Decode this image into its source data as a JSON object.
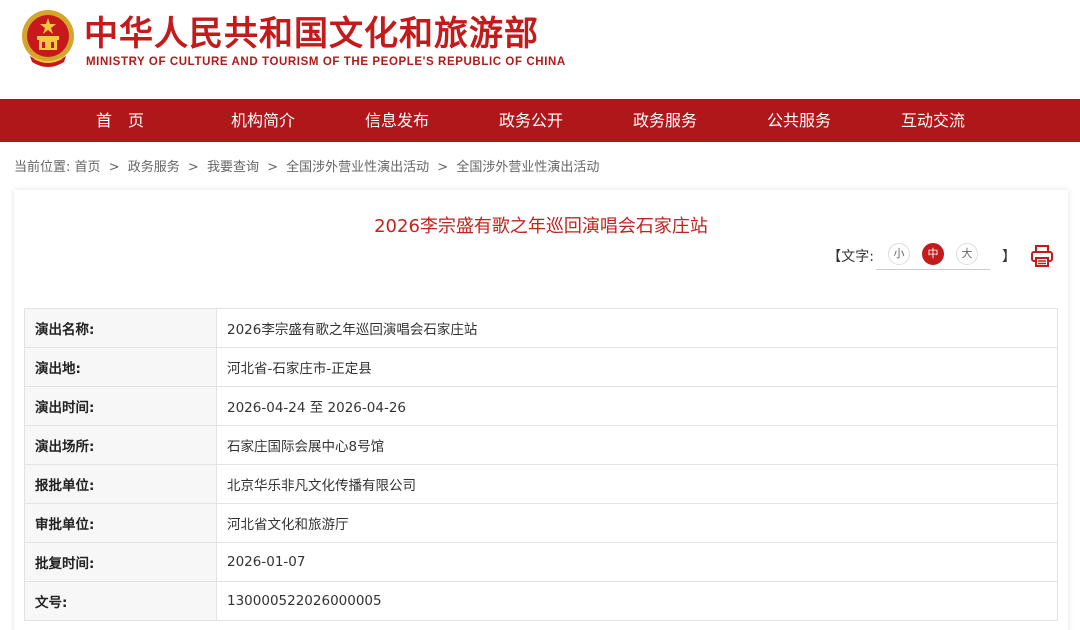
{
  "header": {
    "title_cn": "中华人民共和国文化和旅游部",
    "title_en": "MINISTRY OF CULTURE AND TOURISM OF THE PEOPLE'S REPUBLIC OF CHINA"
  },
  "nav": {
    "items": [
      "首　页",
      "机构简介",
      "信息发布",
      "政务公开",
      "政务服务",
      "公共服务",
      "互动交流"
    ]
  },
  "breadcrumb": {
    "prefix": "当前位置:",
    "items": [
      "首页",
      "政务服务",
      "我要查询",
      "全国涉外营业性演出活动",
      "全国涉外营业性演出活动"
    ],
    "separator": ">"
  },
  "article": {
    "title": "2026李宗盛有歌之年巡回演唱会石家庄站"
  },
  "font_control": {
    "label": "【文字:",
    "small": "小",
    "medium": "中",
    "large": "大",
    "close_bracket": "】",
    "active": "中"
  },
  "details": [
    {
      "label": "演出名称:",
      "value": "2026李宗盛有歌之年巡回演唱会石家庄站"
    },
    {
      "label": "演出地:",
      "value": "河北省-石家庄市-正定县"
    },
    {
      "label": "演出时间:",
      "value": "2026-04-24 至 2026-04-26"
    },
    {
      "label": "演出场所:",
      "value": "石家庄国际会展中心8号馆"
    },
    {
      "label": "报批单位:",
      "value": "北京华乐非凡文化传播有限公司"
    },
    {
      "label": "审批单位:",
      "value": "河北省文化和旅游厅"
    },
    {
      "label": "批复时间:",
      "value": "2026-01-07"
    },
    {
      "label": "文号:",
      "value": "130000522026000005"
    }
  ],
  "colors": {
    "brand_red": "#c31b1b",
    "nav_red": "#b0171b",
    "title_red": "#c02420"
  }
}
